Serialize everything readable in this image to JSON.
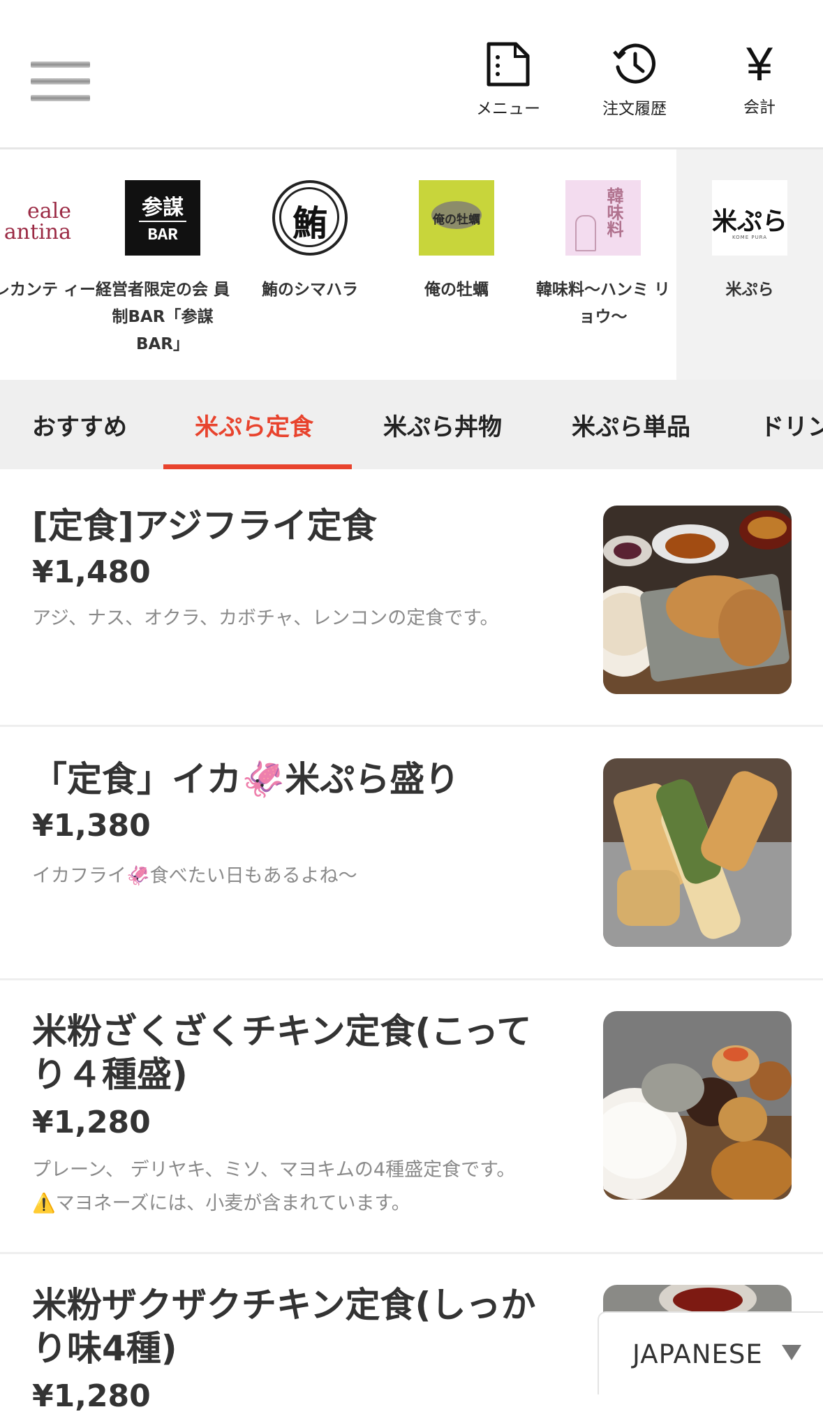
{
  "header": {
    "menu_label": "メニュー",
    "history_label": "注文履歴",
    "checkout_label": "会計",
    "yen_symbol": "¥"
  },
  "shops": [
    {
      "name": "ーレカンテ ィーナ",
      "logo_text": "eale antina"
    },
    {
      "name": "経営者限定の会 員制BAR「参謀 BAR」",
      "logo_text": "参謀 BAR"
    },
    {
      "name": "鮪のシマハラ",
      "logo_text": "鮪"
    },
    {
      "name": "俺の牡蠣",
      "logo_text": "俺の牡蠣"
    },
    {
      "name": "韓味料〜ハンミ リョウ〜",
      "logo_text": "韓味料"
    },
    {
      "name": "米ぷら",
      "logo_text": "米ぷら"
    }
  ],
  "tabs": [
    {
      "label": "おすすめ",
      "active": false
    },
    {
      "label": "米ぷら定食",
      "active": true
    },
    {
      "label": "米ぷら丼物",
      "active": false
    },
    {
      "label": "米ぷら単品",
      "active": false
    },
    {
      "label": "ドリン",
      "active": false
    }
  ],
  "items": [
    {
      "title": "[定食]アジフライ定食",
      "price": "¥1,480",
      "desc": "アジ、ナス、オクラ、カボチャ、レンコンの定食です。"
    },
    {
      "title": "「定食」イカ🦑米ぷら盛り",
      "price": "¥1,380",
      "desc": "イカフライ🦑食べたい日もあるよね〜"
    },
    {
      "title": "米粉ざくざくチキン定食(こってり４種盛)",
      "price": "¥1,280",
      "desc": "プレーン、 デリヤキ、ミソ、マヨキムの4種盛定食です。",
      "desc2": "⚠️マヨネーズには、小麦が含まれています。"
    },
    {
      "title": "米粉ザクザクチキン定食(しっかり味4種)",
      "price": "¥1,280"
    }
  ],
  "language": {
    "selected": "JAPANESE"
  },
  "colors": {
    "accent": "#e8432d",
    "text": "#333333",
    "muted": "#8a8a8a"
  }
}
